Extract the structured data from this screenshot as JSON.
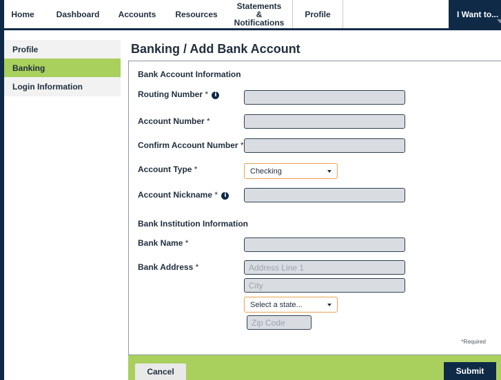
{
  "nav": {
    "items": [
      "Home",
      "Dashboard",
      "Accounts",
      "Resources",
      "Statements &\nNotifications",
      "Profile"
    ],
    "i_want_label": "I Want to..."
  },
  "sidebar": {
    "items": [
      {
        "label": "Profile",
        "active": false
      },
      {
        "label": "Banking",
        "active": true
      },
      {
        "label": "Login Information",
        "active": false
      }
    ]
  },
  "page_title": "Banking / Add Bank Account",
  "bank_account": {
    "section_title": "Bank Account Information",
    "routing_label": "Routing Number",
    "account_label": "Account Number",
    "confirm_label": "Confirm Account Number",
    "type_label": "Account Type",
    "type_value": "Checking",
    "nickname_label": "Account Nickname"
  },
  "bank_institution": {
    "section_title": "Bank Institution Information",
    "name_label": "Bank Name",
    "address_label": "Bank Address",
    "address_placeholder": "Address Line 1",
    "city_placeholder": "City",
    "state_value": "Select a state...",
    "zip_placeholder": "Zip Code"
  },
  "required_marker": "*",
  "required_note": "*Required",
  "info_glyph": "i",
  "buttons": {
    "cancel": "Cancel",
    "submit": "Submit"
  },
  "colors": {
    "navy": "#0f2a47",
    "green": "#a9d05c",
    "input_bg": "#d9dde1",
    "select_border": "#e8a050"
  }
}
